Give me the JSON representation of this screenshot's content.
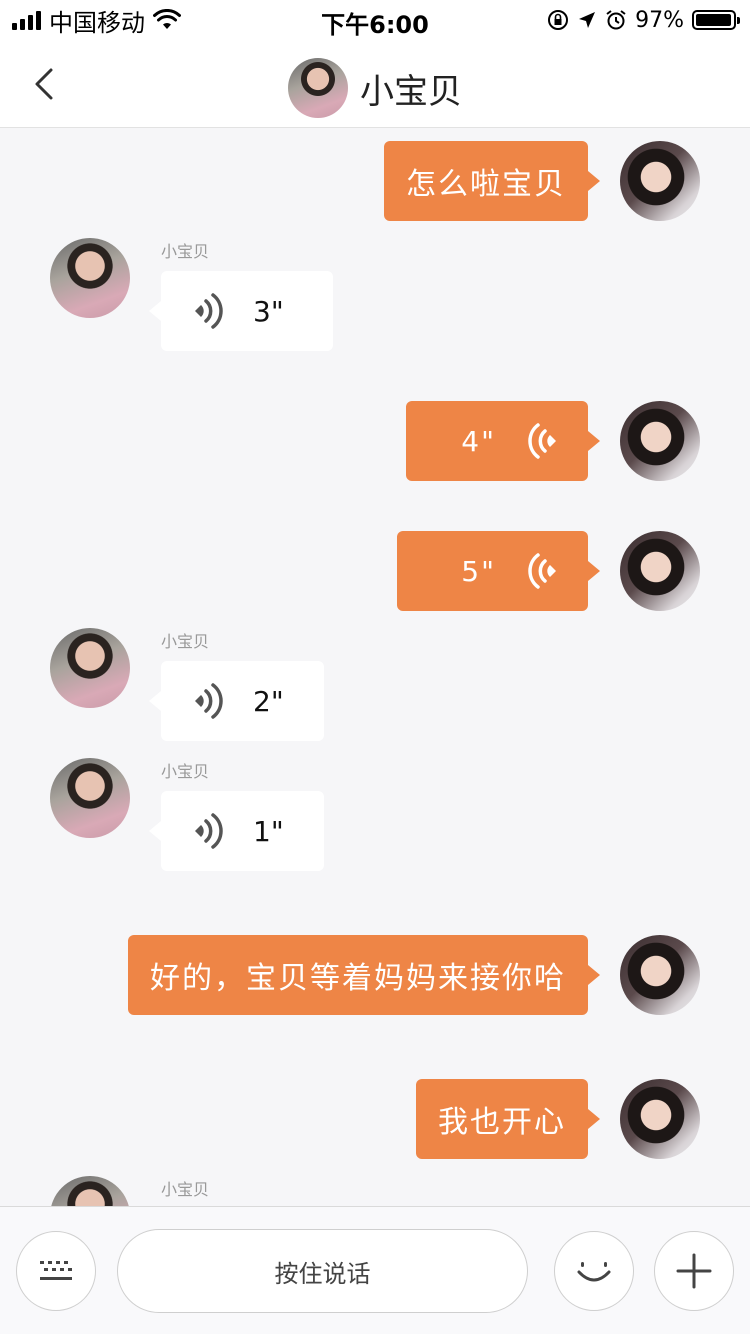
{
  "status_bar": {
    "carrier": "中国移动",
    "time": "下午6:00",
    "battery_percent": "97%",
    "battery_level": 0.97,
    "icons": [
      "signal-icon",
      "wifi-icon",
      "orientation-lock-icon",
      "location-icon",
      "alarm-icon",
      "battery-icon"
    ]
  },
  "header": {
    "title": "小宝贝",
    "back_icon": "chevron-left-icon"
  },
  "messages": [
    {
      "side": "me",
      "type": "text",
      "text": "怎么啦宝贝"
    },
    {
      "side": "other",
      "sender": "小宝贝",
      "type": "voice",
      "duration": "3\""
    },
    {
      "side": "me",
      "type": "voice",
      "duration": "4\""
    },
    {
      "side": "me",
      "type": "voice",
      "duration": "5\""
    },
    {
      "side": "other",
      "sender": "小宝贝",
      "type": "voice",
      "duration": "2\""
    },
    {
      "side": "other",
      "sender": "小宝贝",
      "type": "voice",
      "duration": "1\""
    },
    {
      "side": "me",
      "type": "text",
      "text": "好的，宝贝等着妈妈来接你哈"
    },
    {
      "side": "me",
      "type": "text",
      "text": "我也开心"
    },
    {
      "side": "other",
      "sender": "小宝贝",
      "type": "partial"
    }
  ],
  "input_bar": {
    "hold_to_talk_label": "按住说话",
    "icons": [
      "keyboard-icon",
      "emoji-icon",
      "plus-icon"
    ]
  },
  "colors": {
    "accent": "#ee8546",
    "background": "#f6f6f8",
    "bubble_other": "#ffffff"
  }
}
